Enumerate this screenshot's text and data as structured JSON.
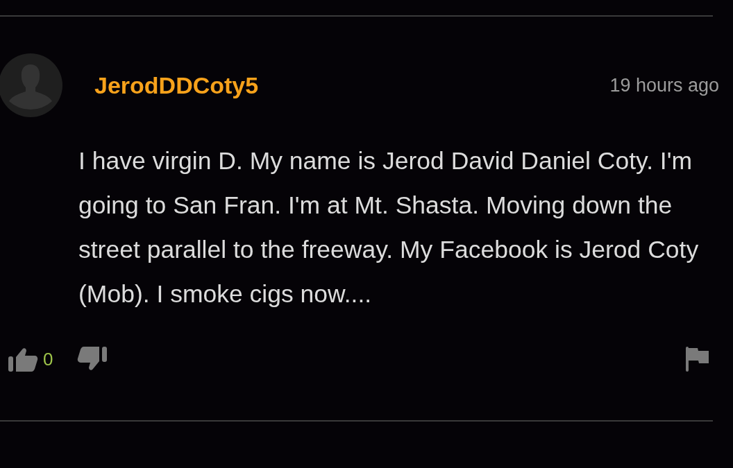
{
  "comment": {
    "username": "JerodDDCoty5",
    "time": "19 hours ago",
    "text": "I have virgin D. My name is Jerod David Daniel Coty. I'm going to San Fran. I'm at Mt. Shasta. Moving down the street parallel to the freeway. My Facebook is Jerod Coty (Mob). I smoke cigs now....",
    "likes": "0"
  }
}
